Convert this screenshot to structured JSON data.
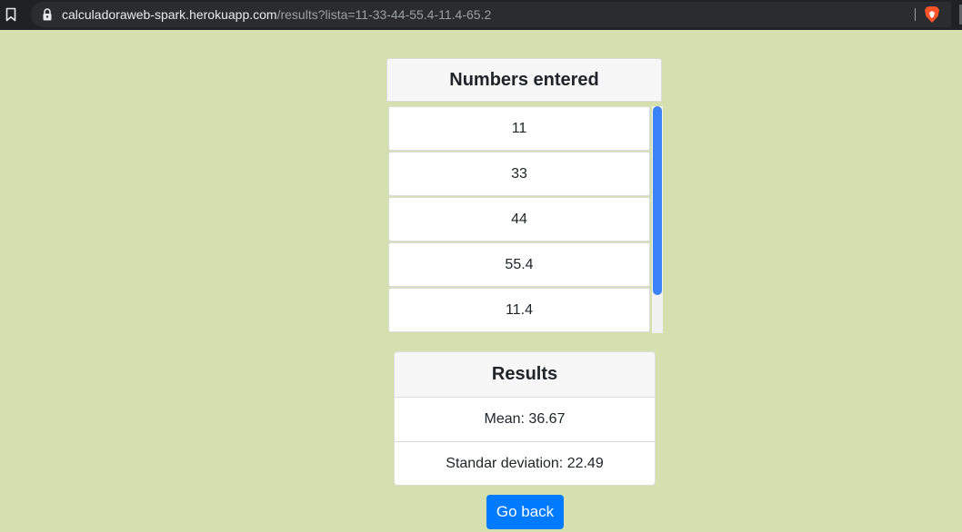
{
  "browser": {
    "url_host": "calculadoraweb-spark.herokuapp.com",
    "url_path": "/results?lista=11-33-44-55.4-11.4-65.2",
    "icons": [
      "bookmark-icon",
      "lock-icon",
      "brave-lion-icon"
    ]
  },
  "numbers": {
    "title": "Numbers entered",
    "items": [
      "11",
      "33",
      "44",
      "55.4",
      "11.4"
    ]
  },
  "results": {
    "title": "Results",
    "mean": "Mean: 36.67",
    "std": "Standar deviation: 22.49"
  },
  "actions": {
    "go_back": "Go back"
  },
  "colors": {
    "page_background": "#d6dfae",
    "button": "#007bff",
    "scrollbar_thumb": "#3b82f6"
  }
}
